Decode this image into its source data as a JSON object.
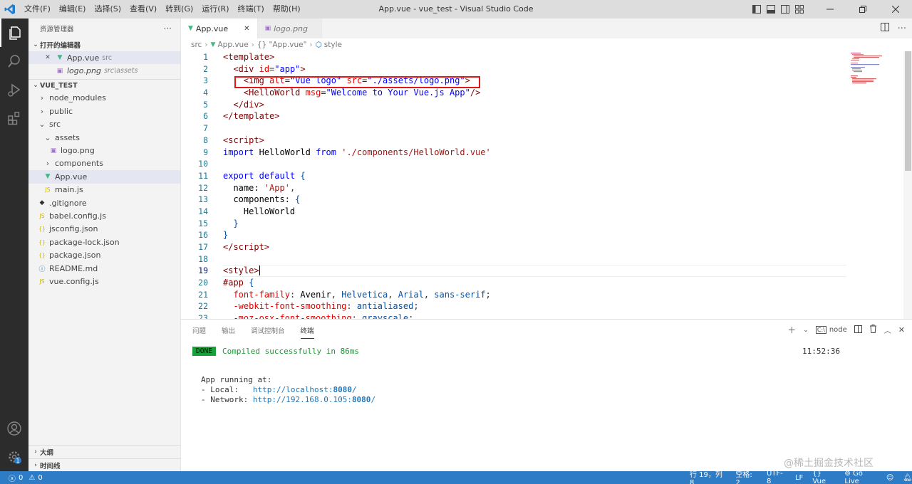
{
  "titlebar": {
    "title": "App.vue - vue_test - Visual Studio Code",
    "menu": [
      "文件(F)",
      "编辑(E)",
      "选择(S)",
      "查看(V)",
      "转到(G)",
      "运行(R)",
      "终端(T)",
      "帮助(H)"
    ]
  },
  "sidebar": {
    "title": "资源管理器",
    "more": "···",
    "open_editors_label": "打开的编辑器",
    "open_editors": [
      {
        "name": "App.vue",
        "desc": "src",
        "close": "✕"
      },
      {
        "name": "logo.png",
        "desc": "src\\assets"
      }
    ],
    "project_label": "VUE_TEST",
    "tree": [
      {
        "name": "node_modules",
        "chev": "›",
        "indent": 0
      },
      {
        "name": "public",
        "chev": "›",
        "indent": 0
      },
      {
        "name": "src",
        "chev": "⌄",
        "indent": 0
      },
      {
        "name": "assets",
        "chev": "⌄",
        "indent": 1
      },
      {
        "name": "logo.png",
        "icon": "image",
        "indent": 2
      },
      {
        "name": "components",
        "chev": "›",
        "indent": 1
      },
      {
        "name": "App.vue",
        "icon": "vue",
        "indent": 1,
        "selected": true
      },
      {
        "name": "main.js",
        "icon": "js",
        "indent": 1
      },
      {
        "name": ".gitignore",
        "icon": "git",
        "indent": 0
      },
      {
        "name": "babel.config.js",
        "icon": "js",
        "indent": 0
      },
      {
        "name": "jsconfig.json",
        "icon": "json",
        "indent": 0
      },
      {
        "name": "package-lock.json",
        "icon": "json",
        "indent": 0
      },
      {
        "name": "package.json",
        "icon": "json",
        "indent": 0
      },
      {
        "name": "README.md",
        "icon": "info",
        "indent": 0
      },
      {
        "name": "vue.config.js",
        "icon": "js",
        "indent": 0
      }
    ],
    "outline_label": "大纲",
    "timeline_label": "时间线"
  },
  "tabs": [
    {
      "label": "App.vue",
      "active": true,
      "close": "✕"
    },
    {
      "label": "logo.png",
      "active": false
    }
  ],
  "breadcrumb": {
    "root": "src",
    "file": "App.vue",
    "section": "{} \"App.vue\"",
    "symbol": "style"
  },
  "editor": {
    "current_line": 19,
    "lines": [
      {
        "n": "1",
        "html": "<span class=\"t-tag\">&lt;template&gt;</span>"
      },
      {
        "n": "2",
        "html": "  <span class=\"t-tag\">&lt;div</span> <span class=\"t-attr\">id</span>=<span class=\"t-str\">\"app\"</span><span class=\"t-tag\">&gt;</span>"
      },
      {
        "n": "3",
        "html": "    <span class=\"t-tag\">&lt;img</span> <span class=\"t-attr\">alt</span>=<span class=\"t-str\">\"Vue logo\"</span> <span class=\"t-attr\">src</span>=<span class=\"t-str\">\"./assets/logo.png\"</span><span class=\"t-tag\">&gt;</span>"
      },
      {
        "n": "4",
        "html": "    <span class=\"t-tag\">&lt;HelloWorld</span> <span class=\"t-attr\">msg</span>=<span class=\"t-str\">\"Welcome to Your Vue.js App\"</span><span class=\"t-tag\">/&gt;</span>"
      },
      {
        "n": "5",
        "html": "  <span class=\"t-tag\">&lt;/div&gt;</span>"
      },
      {
        "n": "6",
        "html": "<span class=\"t-tag\">&lt;/template&gt;</span>"
      },
      {
        "n": "7",
        "html": ""
      },
      {
        "n": "8",
        "html": "<span class=\"t-tag\">&lt;script&gt;</span>"
      },
      {
        "n": "9",
        "html": "<span class=\"t-kw\">import</span> <span class=\"t-txt\">HelloWorld</span> <span class=\"t-kw\">from</span> <span class=\"t-strr\">'./components/HelloWorld.vue'</span>"
      },
      {
        "n": "10",
        "html": ""
      },
      {
        "n": "11",
        "html": "<span class=\"t-kw\">export</span> <span class=\"t-kw\">default</span> <span class=\"t-val\">{</span>"
      },
      {
        "n": "12",
        "html": "  <span class=\"t-txt\">name:</span> <span class=\"t-strr\">'App'</span>,"
      },
      {
        "n": "13",
        "html": "  <span class=\"t-txt\">components:</span> <span class=\"t-val\">{</span>"
      },
      {
        "n": "14",
        "html": "    <span class=\"t-txt\">HelloWorld</span>"
      },
      {
        "n": "15",
        "html": "  <span class=\"t-val\">}</span>"
      },
      {
        "n": "16",
        "html": "<span class=\"t-val\">}</span>"
      },
      {
        "n": "17",
        "html": "<span class=\"t-tag\">&lt;/script&gt;</span>"
      },
      {
        "n": "18",
        "html": ""
      },
      {
        "n": "19",
        "html": "<span class=\"t-tag\">&lt;style&gt;</span>"
      },
      {
        "n": "20",
        "html": "<span class=\"t-sel\">#app</span> <span class=\"t-val\">{</span>"
      },
      {
        "n": "21",
        "html": "  <span class=\"t-prop\">font-family</span>: <span class=\"t-txt\">Avenir</span>, <span class=\"t-val\">Helvetica</span>, <span class=\"t-val\">Arial</span>, <span class=\"t-val\">sans-serif</span>;"
      },
      {
        "n": "22",
        "html": "  <span class=\"t-prop\">-webkit-font-smoothing</span>: <span class=\"t-val\">antialiased</span>;"
      },
      {
        "n": "23",
        "html": "  <span class=\"t-prop\">-moz-osx-font-smoothing</span>: <span class=\"t-val\">grayscale</span>;"
      }
    ]
  },
  "panel": {
    "tabs": [
      "问题",
      "输出",
      "调试控制台",
      "终端"
    ],
    "active_tab": "终端",
    "terminal_name": "node",
    "done": "DONE",
    "compiled": "Compiled successfully in 86ms",
    "time": "11:52:36",
    "running": "App running at:",
    "local_label": "- Local:   ",
    "local_url": "http://localhost:",
    "local_port": "8080",
    "network_label": "- Network: ",
    "network_url": "http://192.168.0.105:",
    "network_port": "8080",
    "slash": "/"
  },
  "statusbar": {
    "errors": "0",
    "warnings": "0",
    "position": "行 19，列 8",
    "spaces": "空格: 2",
    "encoding": "UTF-8",
    "eol": "LF",
    "language": "Vue",
    "golive": "Go Live"
  },
  "watermark": "@稀土掘金技术社区",
  "colors": {
    "statusbar": "#2e7cc6",
    "activitybar": "#2c2c2c",
    "highlight": "#e01818",
    "done": "#1aa03a"
  }
}
